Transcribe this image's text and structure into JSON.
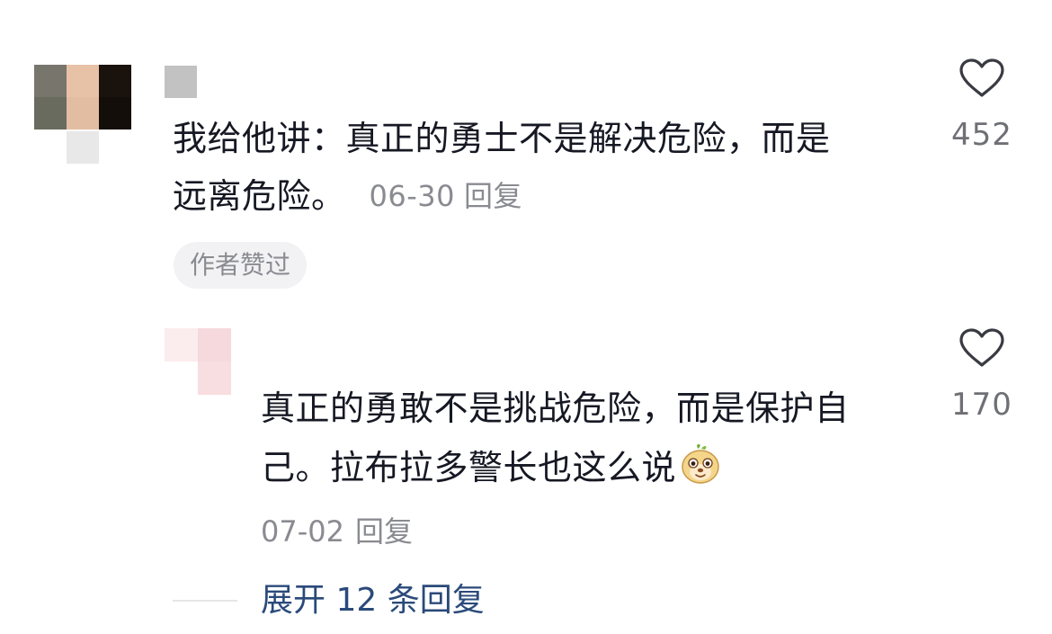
{
  "top_comment": {
    "avatar": "pixelated-avatar",
    "text_line1": "我给他讲：真正的勇士不是解决危险，而是",
    "text_line2": "远离危险。",
    "date": "06-30",
    "reply_label": "回复",
    "badge": "作者赞过",
    "like_icon": "heart-outline-icon",
    "like_count": "452"
  },
  "reply": {
    "avatar": "pixelated-avatar",
    "text_line1": "真正的勇敢不是挑战危险，而是保护自",
    "text_line2": "己。拉布拉多警长也这么说",
    "emoji": "cartoon-face-emoji",
    "date": "07-02",
    "reply_label": "回复",
    "like_icon": "heart-outline-icon",
    "like_count": "170"
  },
  "expand": {
    "label": "展开 12 条回复"
  },
  "colors": {
    "text": "#161823",
    "meta": "#8a8b91",
    "link": "#2a4a7a",
    "badge_bg": "#f2f2f4"
  }
}
